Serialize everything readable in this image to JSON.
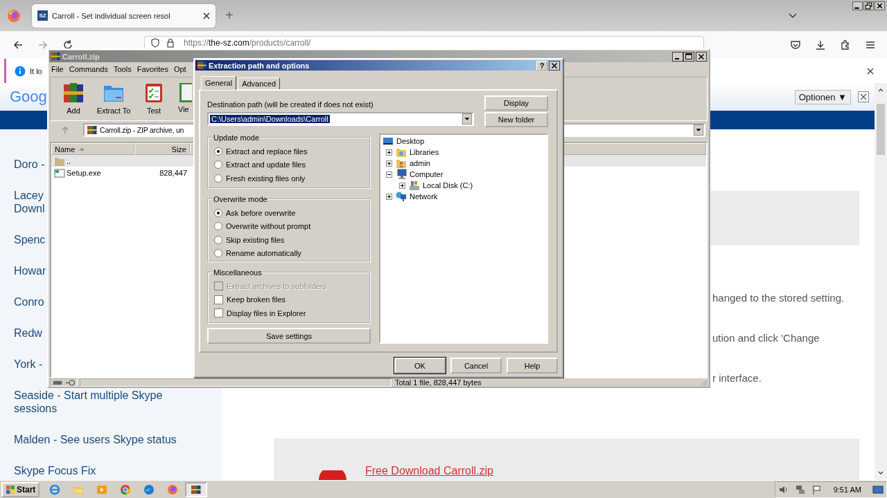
{
  "browser": {
    "tab": {
      "favicon": "SZ",
      "title": "Carroll - Set individual screen resol"
    },
    "new_tab": "+",
    "address": {
      "scheme": "https://",
      "host": "the-sz.com",
      "path": "/products/carroll/"
    },
    "info_bar": {
      "text": "It lo"
    },
    "translate_bar": {
      "logo": "Goog",
      "options": "Optionen ▼"
    }
  },
  "page": {
    "sidebar_links": [
      {
        "lines": [
          "Doro -"
        ]
      },
      {
        "lines": [
          "Lacey",
          "Downl"
        ]
      },
      {
        "lines": [
          "Spenc"
        ]
      },
      {
        "lines": [
          "Howar"
        ]
      },
      {
        "lines": [
          "Conro"
        ]
      },
      {
        "lines": [
          "Redw"
        ]
      },
      {
        "lines": [
          "York -"
        ]
      },
      {
        "lines": [
          "Seaside - Start multiple Skype",
          "sessions"
        ]
      },
      {
        "lines": [
          "Malden - See users Skype status"
        ]
      },
      {
        "lines": [
          "Skype Focus Fix"
        ]
      }
    ],
    "content_fragments": [
      "hanged to the stored setting.",
      "ution and click 'Change",
      "r interface."
    ],
    "download_link": "Free Download Carroll.zip"
  },
  "archiver": {
    "title": "Carroll.zip",
    "menu": [
      "File",
      "Commands",
      "Tools",
      "Favorites",
      "Opt"
    ],
    "toolbar": [
      {
        "kind": "add",
        "label": "Add"
      },
      {
        "kind": "extract",
        "label": "Extract To"
      },
      {
        "kind": "test",
        "label": "Test"
      },
      {
        "kind": "view",
        "label": "Vie"
      }
    ],
    "address": "Carroll.zip - ZIP archive, un",
    "columns": [
      "Name",
      "Size"
    ],
    "files": [
      {
        "kind": "parent",
        "name": ".."
      },
      {
        "kind": "file",
        "name": "Setup.exe",
        "size": "828,447"
      }
    ],
    "status": "Total 1 file, 828,447 bytes"
  },
  "dialog": {
    "title": "Extraction path and options",
    "help": "?",
    "tabs": [
      {
        "label": "General",
        "selected": true
      },
      {
        "label": "Advanced",
        "selected": false
      }
    ],
    "destination_label": "Destination path (will be created if does not exist)",
    "destination_value": "C:\\Users\\admin\\Downloads\\Carroll",
    "side_buttons": [
      "Display",
      "New folder"
    ],
    "groups": [
      {
        "title": "Update mode",
        "options": [
          {
            "kind": "radio",
            "label": "Extract and replace files",
            "selected": true
          },
          {
            "kind": "radio",
            "label": "Extract and update files",
            "selected": false
          },
          {
            "kind": "radio",
            "label": "Fresh existing files only",
            "selected": false
          }
        ]
      },
      {
        "title": "Overwrite mode",
        "options": [
          {
            "kind": "radio",
            "label": "Ask before overwrite",
            "selected": true
          },
          {
            "kind": "radio",
            "label": "Overwrite without prompt",
            "selected": false
          },
          {
            "kind": "radio",
            "label": "Skip existing files",
            "selected": false
          },
          {
            "kind": "radio",
            "label": "Rename automatically",
            "selected": false
          }
        ]
      },
      {
        "title": "Miscellaneous",
        "options": [
          {
            "kind": "checkbox",
            "label": "Extract archives to subfolders",
            "checked": false,
            "disabled": true
          },
          {
            "kind": "checkbox",
            "label": "Keep broken files",
            "checked": false,
            "disabled": false
          },
          {
            "kind": "checkbox",
            "label": "Display files in Explorer",
            "checked": false,
            "disabled": false
          }
        ]
      }
    ],
    "save_button": "Save settings",
    "tree": [
      {
        "kind": "desktop",
        "label": "Desktop",
        "children": [
          {
            "kind": "library",
            "label": "Libraries",
            "expanded": false
          },
          {
            "kind": "user",
            "label": "admin",
            "expanded": false
          },
          {
            "kind": "computer",
            "label": "Computer",
            "expanded": true,
            "children": [
              {
                "kind": "disk",
                "label": "Local Disk (C:)",
                "expanded": false
              }
            ]
          },
          {
            "kind": "network",
            "label": "Network",
            "expanded": false
          }
        ]
      }
    ],
    "buttons": [
      "OK",
      "Cancel",
      "Help"
    ]
  },
  "taskbar": {
    "start": "Start",
    "apps": [
      {
        "kind": "globe",
        "active": false
      },
      {
        "kind": "folder",
        "active": false
      },
      {
        "kind": "media",
        "active": false
      },
      {
        "kind": "ring",
        "active": false
      },
      {
        "kind": "wave",
        "active": false
      },
      {
        "kind": "fox",
        "active": false
      },
      {
        "kind": "archive",
        "active": true
      }
    ],
    "clock": "9:51 AM"
  }
}
